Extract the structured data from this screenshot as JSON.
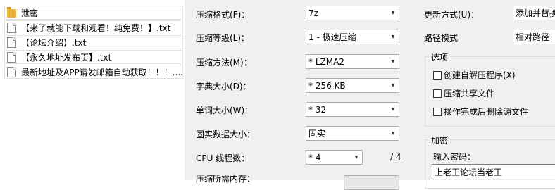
{
  "file_list": [
    {
      "type": "folder",
      "icon": "folder-icon",
      "name": "泄密"
    },
    {
      "type": "file",
      "icon": "text-file-icon",
      "name": "【来了就能下载和观看！纯免费！】.txt"
    },
    {
      "type": "file",
      "icon": "text-file-icon",
      "name": "【论坛介绍】.txt"
    },
    {
      "type": "file",
      "icon": "text-file-icon",
      "name": "【永久地址发布页】.txt"
    },
    {
      "type": "file",
      "icon": "text-file-icon",
      "name": "最新地址及APP请发邮箱自动获取！！！...."
    }
  ],
  "settings": {
    "format": {
      "label": "压缩格式(F)：",
      "value": "7z"
    },
    "level": {
      "label": "压缩等级(L)：",
      "value": "1 - 极速压缩"
    },
    "method": {
      "label": "压缩方法(M)：",
      "value": "* LZMA2"
    },
    "dictionary": {
      "label": "字典大小(D)：",
      "value": "* 256 KB"
    },
    "word_size": {
      "label": "单词大小(W)：",
      "value": "* 32"
    },
    "solid": {
      "label": "固实数据大小：",
      "value": "固实"
    },
    "threads": {
      "label": "CPU 线程数：",
      "value": "* 4",
      "max": "/ 4"
    },
    "memory": {
      "label": "压缩所需内存："
    }
  },
  "right_panel": {
    "update_mode": {
      "label": "更新方式(U)：",
      "value": "添加并替换"
    },
    "path_mode": {
      "label": "路径模式",
      "value": "相对路径"
    },
    "options": {
      "title": "选项",
      "items": [
        {
          "label": "创建自解压程序(X)",
          "checked": false
        },
        {
          "label": "压缩共享文件",
          "checked": false
        },
        {
          "label": "操作完成后删除源文件",
          "checked": false
        }
      ]
    },
    "encryption": {
      "title": "加密",
      "password_label": "输入密码：",
      "password_value": "上老王论坛当老王"
    }
  }
}
